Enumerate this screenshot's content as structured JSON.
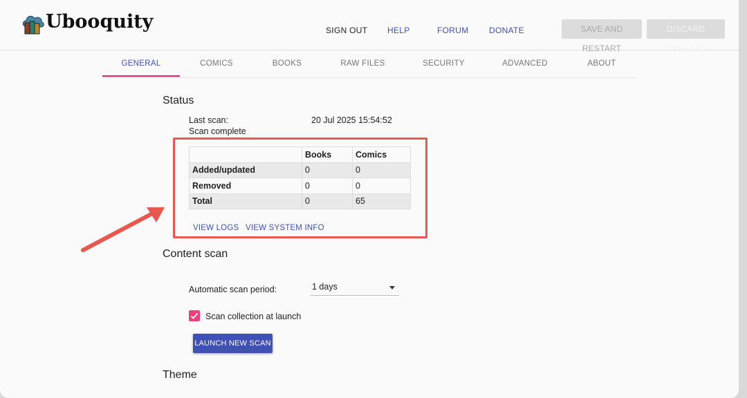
{
  "app": {
    "name": "Ubooquity"
  },
  "header": {
    "links": {
      "sign_out": "SIGN OUT",
      "help": "HELP",
      "forum": "FORUM",
      "donate": "DONATE"
    },
    "save_restart": "SAVE AND RESTART",
    "discard_changes": "DISCARD CHANGES"
  },
  "tabs": {
    "general": "GENERAL",
    "comics": "COMICS",
    "books": "BOOKS",
    "raw_files": "RAW FILES",
    "security": "SECURITY",
    "advanced": "ADVANCED",
    "about": "ABOUT",
    "active": "GENERAL"
  },
  "status": {
    "title": "Status",
    "last_scan_label": "Last scan:",
    "last_scan_value": "20 Jul 2025 15:54:52",
    "scan_state": "Scan complete",
    "table": {
      "headers": [
        "",
        "Books",
        "Comics"
      ],
      "rows": [
        {
          "label": "Added/updated",
          "books": "0",
          "comics": "0"
        },
        {
          "label": "Removed",
          "books": "0",
          "comics": "0"
        },
        {
          "label": "Total",
          "books": "0",
          "comics": "65"
        }
      ]
    },
    "view_logs": "VIEW LOGS",
    "view_system_info": "VIEW SYSTEM INFO"
  },
  "content_scan": {
    "title": "Content scan",
    "period_label": "Automatic scan period:",
    "period_value": "1 days",
    "scan_at_launch_label": "Scan collection at launch",
    "scan_at_launch_checked": true,
    "launch_button": "LAUNCH NEW SCAN"
  },
  "theme": {
    "title": "Theme"
  },
  "colors": {
    "primary": "#3f51b5",
    "accent": "#e91e63",
    "checkbox": "#ec407a",
    "annotation": "#e8584f"
  }
}
